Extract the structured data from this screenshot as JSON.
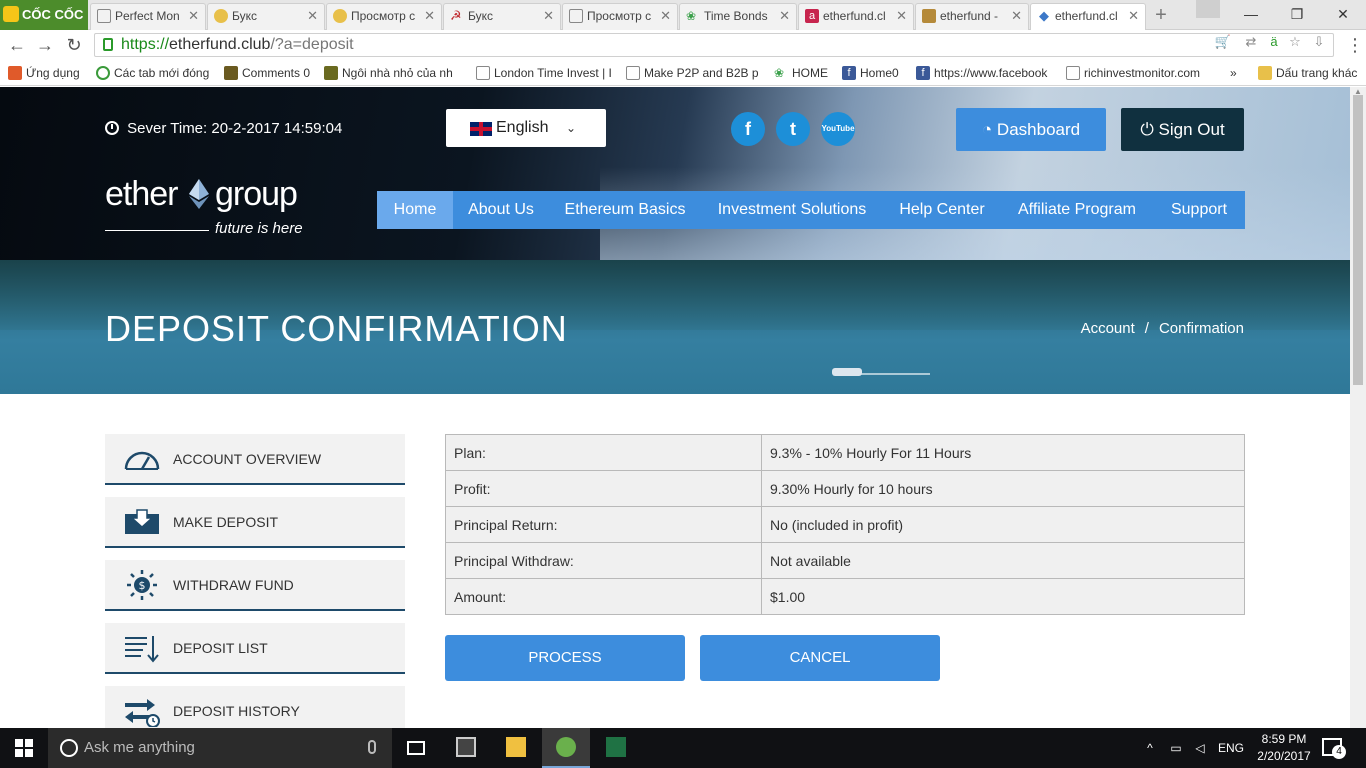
{
  "browser": {
    "brand": "CỐC CỐC",
    "tabs": [
      {
        "title": "Perfect Mon",
        "icon": "doc-icon",
        "color": "#888888"
      },
      {
        "title": "Букс",
        "icon": "coin-icon",
        "color": "#e8c04a"
      },
      {
        "title": "Просмотр с",
        "icon": "coin-icon",
        "color": "#e8c04a"
      },
      {
        "title": "Букс",
        "icon": "hammer-sickle-icon",
        "color": "#c0282e"
      },
      {
        "title": "Просмотр с",
        "icon": "page-icon",
        "color": "#888888"
      },
      {
        "title": "Time Bonds",
        "icon": "paw-icon",
        "color": "#3aa04a"
      },
      {
        "title": "etherfund.cl",
        "icon": "a-icon",
        "color": "#c7254e"
      },
      {
        "title": "etherfund -",
        "icon": "coins-icon",
        "color": "#b58a3a"
      },
      {
        "title": "etherfund.cl",
        "icon": "ethereum-icon",
        "color": "#3c78c8"
      }
    ],
    "url": {
      "scheme": "https://",
      "host": "etherfund.club",
      "path": "/?a=deposit"
    },
    "bookmarks": [
      {
        "label": "Ứng dụng",
        "icon": "apps-grid-icon",
        "color": "#e05a2a"
      },
      {
        "label": "Các tab mới đóng",
        "icon": "history-icon",
        "color": "#3a9a3a"
      },
      {
        "label": "Comments 0",
        "icon": "thumb-icon",
        "color": "#6a5a20"
      },
      {
        "label": "Ngôi nhà nhỏ của nh",
        "icon": "thumb-icon",
        "color": "#6a6a20"
      },
      {
        "label": "London Time Invest | I",
        "icon": "page-icon",
        "color": "#888888"
      },
      {
        "label": "Make P2P and B2B pa",
        "icon": "page-icon",
        "color": "#888888"
      },
      {
        "label": "HOME",
        "icon": "paw-icon",
        "color": "#3aa04a"
      },
      {
        "label": "Home0",
        "icon": "facebook-icon",
        "color": "#3b5998"
      },
      {
        "label": "https://www.facebook",
        "icon": "facebook-icon",
        "color": "#3b5998"
      },
      {
        "label": "richinvestmonitor.com",
        "icon": "page-icon",
        "color": "#888888"
      },
      {
        "label": "Dấu trang khác",
        "icon": "folder-icon",
        "color": "#e8c04a"
      }
    ],
    "more_bookmarks": "»"
  },
  "header": {
    "server_time_label": "Sever Time:",
    "server_time": "20-2-2017 14:59:04",
    "language": "English",
    "social": [
      {
        "name": "facebook-icon",
        "glyph": "f"
      },
      {
        "name": "twitter-icon",
        "glyph": "t"
      },
      {
        "name": "youtube-icon",
        "glyph": "YouTube"
      }
    ],
    "dashboard_label": "Dashboard",
    "signout_label": "Sign Out",
    "logo_left": "ether",
    "logo_right": "group",
    "logo_tagline": "future is here",
    "nav": [
      "Home",
      "About Us",
      "Ethereum Basics",
      "Investment Solutions",
      "Help Center",
      "Affiliate Program",
      "Support"
    ],
    "nav_active": "Home"
  },
  "banner": {
    "title": "DEPOSIT CONFIRMATION",
    "breadcrumb": [
      "Account",
      "/",
      "Confirmation"
    ]
  },
  "sidebar": [
    {
      "label": "ACCOUNT OVERVIEW",
      "icon": "gauge-icon"
    },
    {
      "label": "MAKE DEPOSIT",
      "icon": "deposit-tray-icon"
    },
    {
      "label": "WITHDRAW FUND",
      "icon": "dollar-coin-icon"
    },
    {
      "label": "DEPOSIT LIST",
      "icon": "list-download-icon"
    },
    {
      "label": "DEPOSIT HISTORY",
      "icon": "transfer-clock-icon"
    }
  ],
  "deposit": {
    "rows": [
      {
        "label": "Plan:",
        "value": "9.3% - 10% Hourly For 11 Hours"
      },
      {
        "label": "Profit:",
        "value": "9.30% Hourly for 10 hours"
      },
      {
        "label": "Principal Return:",
        "value": "No (included in profit)"
      },
      {
        "label": "Principal Withdraw:",
        "value": "Not available"
      },
      {
        "label": "Amount:",
        "value": "$1.00"
      }
    ],
    "process_label": "PROCESS",
    "cancel_label": "CANCEL"
  },
  "taskbar": {
    "search_placeholder": "Ask me anything",
    "language": "ENG",
    "time": "8:59 PM",
    "date": "2/20/2017",
    "notifications": "4"
  },
  "colors": {
    "accent": "#3d8ddd",
    "nav_active": "#6aa9ec",
    "signout": "#10303f",
    "sidebar_border": "#1e4a6a"
  }
}
